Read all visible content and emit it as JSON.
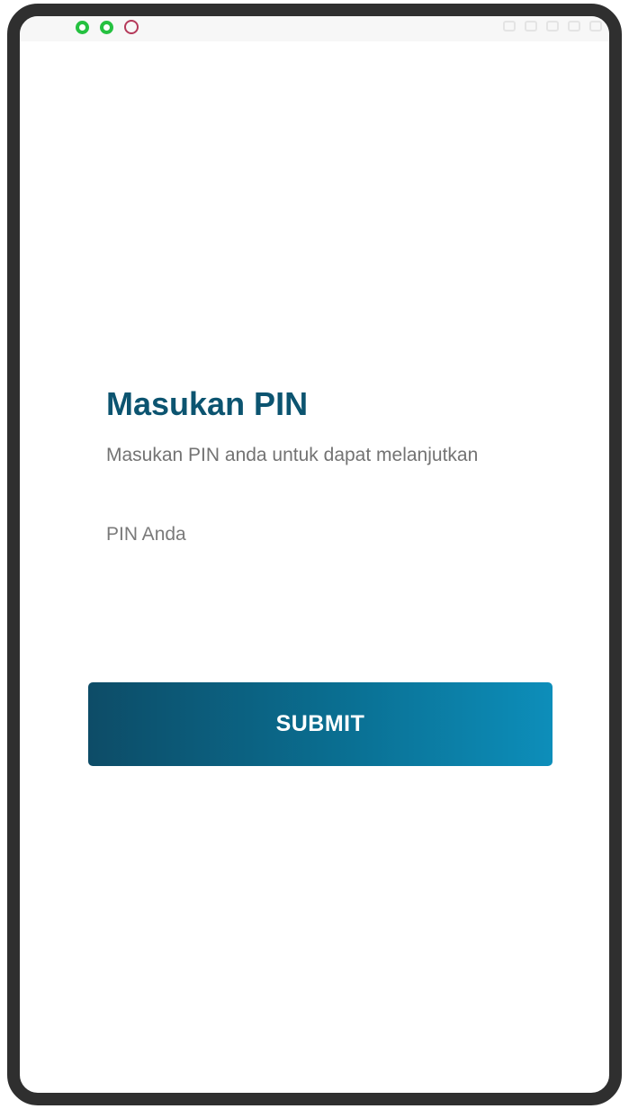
{
  "status_bar": {
    "left_icons": [
      "whatsapp-icon",
      "whatsapp-icon",
      "app-logo-icon"
    ]
  },
  "pin_screen": {
    "title": "Masukan PIN",
    "subtitle": "Masukan PIN anda untuk dapat melanjutkan",
    "pin_placeholder": "PIN Anda",
    "pin_value": "",
    "submit_label": "SUBMIT"
  },
  "colors": {
    "title": "#0c5470",
    "button_gradient_start": "#0d4c67",
    "button_gradient_end": "#0d8eba",
    "subtitle": "#737373",
    "frame": "#2f2f2f"
  }
}
